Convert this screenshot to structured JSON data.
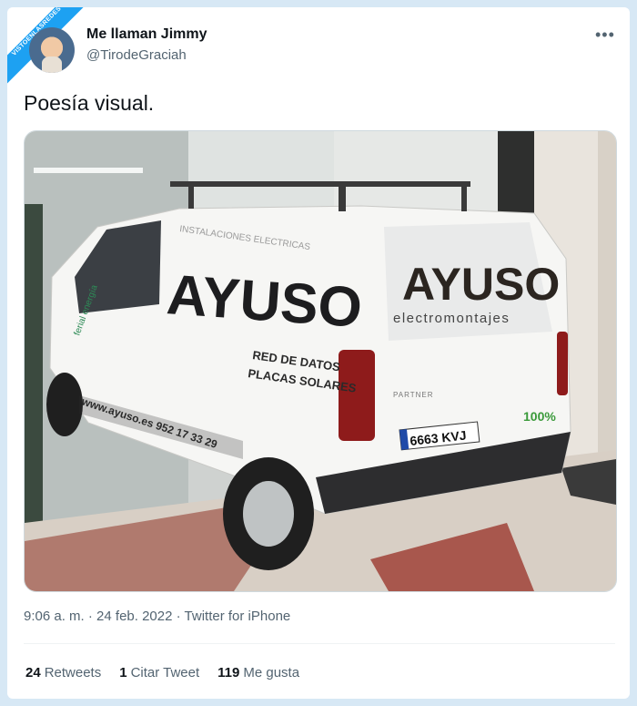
{
  "watermark": {
    "line1": "VISTOENLASREDES",
    "line2": ".com"
  },
  "author": {
    "name": "Me llaman Jimmy",
    "handle": "@TirodeGraciah"
  },
  "menu_icon": "more-dots-icon",
  "tweet": {
    "text": "Poesía visual."
  },
  "photo": {
    "brand": "AYUSO",
    "brand_sub": "electromontajes",
    "side_top": "INSTALACIONES ELECTRICAS",
    "side_line1": "RED DE DATOS",
    "side_line2": "PLACAS SOLARES",
    "side_web": "www.ayuso.es 952 17 33 29",
    "door_text": "ferial energía",
    "plate": "6663 KVJ",
    "model": "PARTNER",
    "badge": "100%"
  },
  "meta": {
    "time": "9:06 a. m.",
    "date": "24 feb. 2022",
    "client": "Twitter for iPhone",
    "separator": "·"
  },
  "stats": [
    {
      "count": "24",
      "label": "Retweets"
    },
    {
      "count": "1",
      "label": "Citar Tweet"
    },
    {
      "count": "119",
      "label": "Me gusta"
    }
  ]
}
